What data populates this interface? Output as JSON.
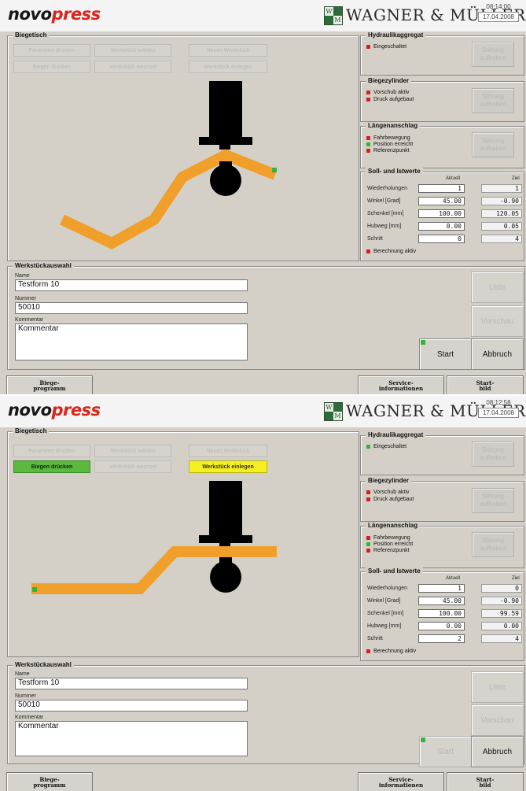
{
  "brand": {
    "novo": "novo",
    "press": "press",
    "wm_monogram": [
      "W",
      "",
      "",
      "M"
    ],
    "wm_name": "WAGNER & MÜLLER"
  },
  "screens": [
    {
      "time": "08:14:00",
      "date": "17.04.2008",
      "biegetisch": {
        "title": "Biegetisch",
        "buttons": [
          {
            "label": "Parameter drücken",
            "state": "disabled"
          },
          {
            "label": "Werkstück wählen",
            "state": "disabled"
          },
          {
            "label": "Neues Werkstück",
            "state": "disabled"
          },
          {
            "label": "Biegen drücken",
            "state": "disabled"
          },
          {
            "label": "Werkstück wechsel",
            "state": "disabled"
          },
          {
            "label": "Werkstück einlegen",
            "state": "disabled"
          }
        ]
      },
      "hydraulik": {
        "title": "Hydraulikaggregat",
        "items": [
          {
            "label": "Eingeschaltet",
            "status": "red"
          }
        ],
        "button": "Störung aufheben"
      },
      "biegezylinder": {
        "title": "Biegezylinder",
        "items": [
          {
            "label": "Vorschub aktiv",
            "status": "red"
          },
          {
            "label": "Druck aufgebaut",
            "status": "red"
          }
        ],
        "button": "Störung aufheben"
      },
      "laengenanschlag": {
        "title": "Längenanschlag",
        "items": [
          {
            "label": "Fahrbewegung",
            "status": "red"
          },
          {
            "label": "Position erreicht",
            "status": "green"
          },
          {
            "label": "Referenzpunkt",
            "status": "red"
          }
        ],
        "button": "Störung aufheben"
      },
      "sollist": {
        "title": "Soll- und Istwerte",
        "col_aktuell": "Aktuell",
        "col_ziel": "Ziel",
        "rows": [
          {
            "label": "Wiederholungen",
            "aktuell": "1",
            "ziel": "1"
          },
          {
            "label": "Winkel [Grad]",
            "aktuell": "45.00",
            "ziel": "-0.90"
          },
          {
            "label": "Schenkel [mm]",
            "aktuell": "100.00",
            "ziel": "120.05"
          },
          {
            "label": "Hubweg [mm]",
            "aktuell": "0.00",
            "ziel": "0.05"
          },
          {
            "label": "Schritt",
            "aktuell": "0",
            "ziel": "4"
          }
        ],
        "status": {
          "label": "Berechnung aktiv",
          "status": "red"
        }
      },
      "werkstueck": {
        "title": "Werkstückauswahl",
        "name_label": "Name",
        "name_value": "Testform 10",
        "nummer_label": "Nummer",
        "nummer_value": "50010",
        "kommentar_label": "Kommentar",
        "kommentar_value": "Kommentar"
      },
      "side_buttons": {
        "liste": "Liste",
        "vorschau": "Vorschau",
        "start": "Start",
        "abbruch": "Abbruch",
        "start_enabled": true
      },
      "bottom": {
        "biegeprogramm": [
          "Biege-",
          "programm"
        ],
        "service": [
          "Service-",
          "informationen"
        ],
        "startbild": [
          "Start-",
          "bild"
        ]
      }
    },
    {
      "time": "08:12:58",
      "date": "17.04.2008",
      "biegetisch": {
        "title": "Biegetisch",
        "buttons": [
          {
            "label": "Parameter drücken",
            "state": "disabled"
          },
          {
            "label": "Werkstück wählen",
            "state": "disabled"
          },
          {
            "label": "Neues Werkstück",
            "state": "disabled"
          },
          {
            "label": "Biegen drücken",
            "state": "green"
          },
          {
            "label": "Werkstück wechsel",
            "state": "disabled"
          },
          {
            "label": "Werkstück einlegen",
            "state": "yellow"
          }
        ]
      },
      "hydraulik": {
        "title": "Hydraulikaggregat",
        "items": [
          {
            "label": "Eingeschaltet",
            "status": "green"
          }
        ],
        "button": "Störung aufheben"
      },
      "biegezylinder": {
        "title": "Biegezylinder",
        "items": [
          {
            "label": "Vorschub aktiv",
            "status": "red"
          },
          {
            "label": "Druck aufgebaut",
            "status": "red"
          }
        ],
        "button": "Störung aufheben"
      },
      "laengenanschlag": {
        "title": "Längenanschlag",
        "items": [
          {
            "label": "Fahrbewegung",
            "status": "red"
          },
          {
            "label": "Position erreicht",
            "status": "green"
          },
          {
            "label": "Referenzpunkt",
            "status": "red"
          }
        ],
        "button": "Störung aufheben"
      },
      "sollist": {
        "title": "Soll- und Istwerte",
        "col_aktuell": "Aktuell",
        "col_ziel": "Ziel",
        "rows": [
          {
            "label": "Wiederholungen",
            "aktuell": "1",
            "ziel": "0"
          },
          {
            "label": "Winkel [Grad]",
            "aktuell": "45.00",
            "ziel": "-0.90"
          },
          {
            "label": "Schenkel [mm]",
            "aktuell": "100.00",
            "ziel": "99.59"
          },
          {
            "label": "Hubweg [mm]",
            "aktuell": "0.00",
            "ziel": "0.00"
          },
          {
            "label": "Schritt",
            "aktuell": "2",
            "ziel": "4"
          }
        ],
        "status": {
          "label": "Berechnung aktiv",
          "status": "red"
        }
      },
      "werkstueck": {
        "title": "Werkstückauswahl",
        "name_label": "Name",
        "name_value": "Testform 10",
        "nummer_label": "Nummer",
        "nummer_value": "50010",
        "kommentar_label": "Kommentar",
        "kommentar_value": "Kommentar"
      },
      "side_buttons": {
        "liste": "Liste",
        "vorschau": "Vorschau",
        "start": "Start",
        "abbruch": "Abbruch",
        "start_enabled": false
      },
      "bottom": {
        "biegeprogramm": [
          "Biege-",
          "programm"
        ],
        "service": [
          "Service-",
          "informationen"
        ],
        "startbild": [
          "Start-",
          "bild"
        ]
      }
    }
  ],
  "colors": {
    "workpiece": "#f0a02a",
    "tool": "#000000",
    "led_red": "#d32121",
    "led_green": "#37b13b"
  }
}
